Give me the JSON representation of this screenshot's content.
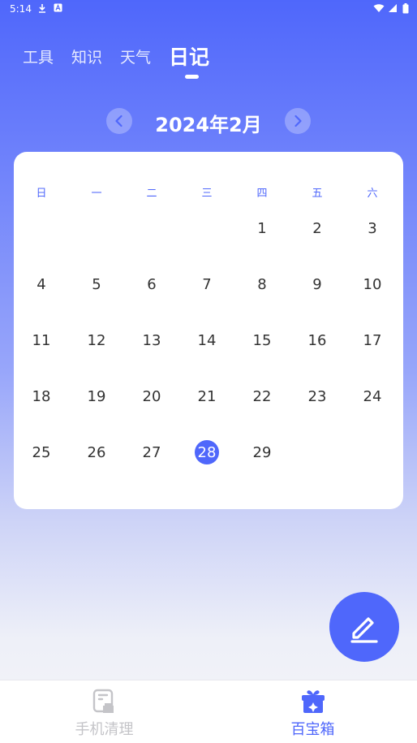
{
  "status_bar": {
    "time": "5:14",
    "icons": [
      "download-icon",
      "a-icon",
      "wifi-icon",
      "signal-icon",
      "battery-icon"
    ]
  },
  "tabs": [
    {
      "label": "工具",
      "active": false
    },
    {
      "label": "知识",
      "active": false
    },
    {
      "label": "天气",
      "active": false
    },
    {
      "label": "日记",
      "active": true
    }
  ],
  "calendar": {
    "month_title": "2024年2月",
    "weekdays": [
      "日",
      "一",
      "二",
      "三",
      "四",
      "五",
      "六"
    ],
    "weeks": [
      [
        "",
        "",
        "",
        "",
        "1",
        "2",
        "3"
      ],
      [
        "4",
        "5",
        "6",
        "7",
        "8",
        "9",
        "10"
      ],
      [
        "11",
        "12",
        "13",
        "14",
        "15",
        "16",
        "17"
      ],
      [
        "18",
        "19",
        "20",
        "21",
        "22",
        "23",
        "24"
      ],
      [
        "25",
        "26",
        "27",
        "28",
        "29",
        "",
        ""
      ]
    ],
    "selected_day": "28"
  },
  "fab": {
    "icon": "edit-pencil-icon"
  },
  "bottom_nav": [
    {
      "label": "手机清理",
      "icon": "phone-clean-icon",
      "active": false
    },
    {
      "label": "百宝箱",
      "icon": "treasure-box-icon",
      "active": true
    }
  ],
  "colors": {
    "accent": "#4f67fb",
    "inactive": "#c4c4c8",
    "text": "#333333"
  }
}
